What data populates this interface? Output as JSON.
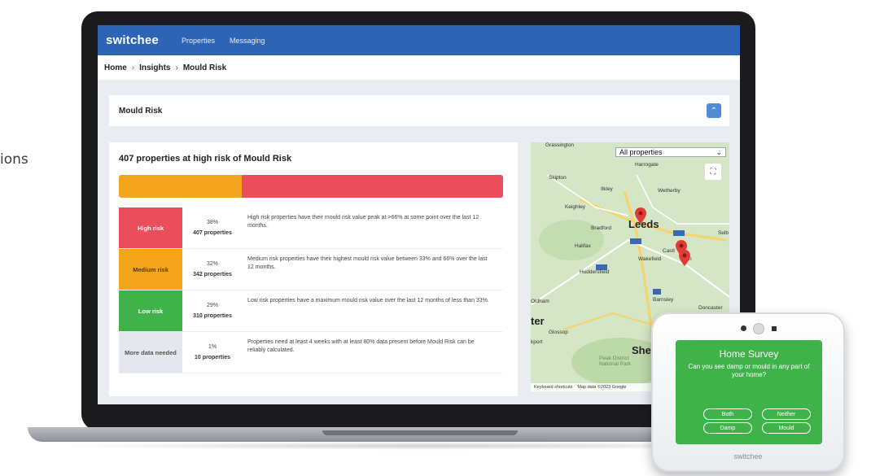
{
  "side_text": "ions",
  "app": {
    "brand": "switchee",
    "nav": [
      "Properties",
      "Messaging"
    ],
    "breadcrumb": [
      "Home",
      "Insights",
      "Mould Risk"
    ],
    "panel_title": "Mould Risk",
    "card_title": "407 properties at high risk of Mould Risk",
    "risk_bar": [
      {
        "color": "#f4a51c",
        "fraction": 0.32
      },
      {
        "color": "#ea4d5c",
        "fraction": 0.68
      }
    ],
    "rows": [
      {
        "label": "High risk",
        "color": "#ea4d5c",
        "text_color": "#ffffff",
        "pct": "38%",
        "count": "407 properties",
        "desc": "High risk properties have their mould risk value peak at >66% at some point over the last 12 months."
      },
      {
        "label": "Medium risk",
        "color": "#f4a51c",
        "text_color": "#5a3b00",
        "pct": "32%",
        "count": "342 properties",
        "desc": "Medium risk properties have their highest mould risk value between 33% and 66% over the last 12 months."
      },
      {
        "label": "Low risk",
        "color": "#3fb24a",
        "text_color": "#ffffff",
        "pct": "29%",
        "count": "310 properties",
        "desc": "Low risk properties have a maximum mould risk value over the last 12 months of less than 33%."
      },
      {
        "label": "More data needed",
        "color": "#e4e7ee",
        "text_color": "#555555",
        "pct": "1%",
        "count": "10 properties",
        "desc": "Properties need at least 4 weeks with at least 80% data present before Mould Risk can be reliably calculated."
      }
    ]
  },
  "map": {
    "select_value": "All properties",
    "towns": [
      {
        "name": "Grassington"
      },
      {
        "name": "Harrogate"
      },
      {
        "name": "Skipton"
      },
      {
        "name": "Ilkley"
      },
      {
        "name": "Wetherby"
      },
      {
        "name": "Keighley"
      },
      {
        "name": "Bradford"
      },
      {
        "name": "Leeds"
      },
      {
        "name": "Halifax"
      },
      {
        "name": "Wakefield"
      },
      {
        "name": "Huddersfield"
      },
      {
        "name": "Barnsley"
      },
      {
        "name": "Doncaster"
      },
      {
        "name": "Glossop"
      },
      {
        "name": "Peak District National Park"
      },
      {
        "name": "Oldham"
      },
      {
        "name": "She"
      },
      {
        "name": "ter"
      },
      {
        "name": "kport"
      },
      {
        "name": "Castl"
      },
      {
        "name": "Pon"
      },
      {
        "name": "Selb"
      }
    ],
    "footer": [
      "Keyboard shortcuts",
      "Map data ©2023 Google"
    ]
  },
  "device": {
    "title": "Home Survey",
    "question": "Can you see damp or mould in any part of your home?",
    "buttons": [
      "Both",
      "Neither",
      "Damp",
      "Mould"
    ],
    "brand": "switchee"
  }
}
